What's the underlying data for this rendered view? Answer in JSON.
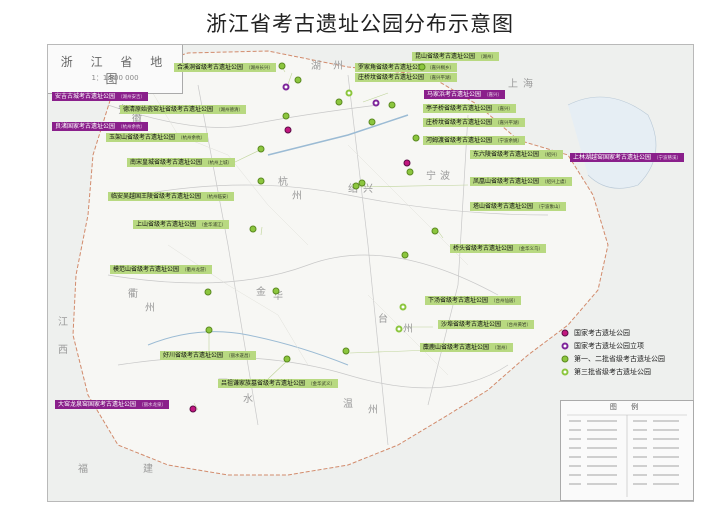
{
  "title": "浙江省考古遗址公园分布示意图",
  "inset": {
    "title": "浙 江 省 地 图",
    "scale": "1：1 800 000"
  },
  "legend": [
    {
      "key": "national",
      "label": "国家考古遗址公园"
    },
    {
      "key": "national-proj",
      "label": "国家考古遗址公园立项"
    },
    {
      "key": "prov12",
      "label": "第一、二批省级考古遗址公园"
    },
    {
      "key": "prov3",
      "label": "第三批省级考古遗址公园"
    }
  ],
  "map_legend_title": "图 例",
  "regions": [
    "湖",
    "州",
    "杭",
    "州",
    "绍",
    "兴",
    "宁",
    "波",
    "金",
    "华",
    "衢",
    "州",
    "台",
    "州",
    "丽",
    "水",
    "温",
    "州",
    "福",
    "建",
    "江",
    "西",
    "安",
    "徽",
    "上",
    "海"
  ],
  "colors": {
    "national": "#c2177f",
    "national_proj": "#7d259a",
    "provincial": "#8cc63e",
    "label_green": "#b8d981",
    "label_purple": "#8a1f8b"
  },
  "sites": [
    {
      "name": "昆山省级考古遗址公园",
      "sub": "（湖州）",
      "type": "prov12",
      "style": "green"
    },
    {
      "name": "合溪洞省级考古遗址公园",
      "sub": "（湖州长兴）",
      "type": "prov12",
      "style": "green"
    },
    {
      "name": "罗家角省级考古遗址公园",
      "sub": "（嘉兴桐乡）",
      "type": "prov3",
      "style": "green"
    },
    {
      "name": "庄桥坟省级考古遗址公园",
      "sub": "（嘉兴平湖）",
      "type": "prov12",
      "style": "green"
    },
    {
      "name": "马家浜考古遗址公园",
      "sub": "（嘉兴）",
      "type": "national-proj",
      "style": "purple"
    },
    {
      "name": "安吉古城考古遗址公园",
      "sub": "（湖州安吉）",
      "type": "national-proj",
      "style": "purple"
    },
    {
      "name": "德清原始瓷窑址省级考古遗址公园",
      "sub": "（湖州德清）",
      "type": "prov12",
      "style": "green"
    },
    {
      "name": "良渚国家考古遗址公园",
      "sub": "（杭州余杭）",
      "type": "national",
      "style": "purple"
    },
    {
      "name": "玉架山省级考古遗址公园",
      "sub": "（杭州余杭）",
      "type": "prov12",
      "style": "green"
    },
    {
      "name": "亭子桥省级考古遗址公园",
      "sub": "（嘉兴）",
      "type": "prov12",
      "style": "green"
    },
    {
      "name": "庄桥坟省级考古遗址公园",
      "sub": "（嘉兴平湖）",
      "type": "prov12",
      "style": "green"
    },
    {
      "name": "河姆渡省级考古遗址公园",
      "sub": "（宁波余姚）",
      "type": "prov12",
      "style": "green"
    },
    {
      "name": "南宋皇城省级考古遗址公园",
      "sub": "（杭州上城）",
      "type": "prov12",
      "style": "green"
    },
    {
      "name": "东六陵省级考古遗址公园",
      "sub": "（绍兴）",
      "type": "prov12",
      "style": "green"
    },
    {
      "name": "上林湖越窑国家考古遗址公园",
      "sub": "（宁波慈溪）",
      "type": "national",
      "style": "purple"
    },
    {
      "name": "凤凰山省级考古遗址公园",
      "sub": "（绍兴上虞）",
      "type": "prov12",
      "style": "green"
    },
    {
      "name": "临安吴越国王陵省级考古遗址公园",
      "sub": "（杭州临安）",
      "type": "prov12",
      "style": "green"
    },
    {
      "name": "塔山省级考古遗址公园",
      "sub": "（宁波象山）",
      "type": "prov12",
      "style": "green"
    },
    {
      "name": "上山省级考古遗址公园",
      "sub": "（金华浦江）",
      "type": "prov12",
      "style": "green"
    },
    {
      "name": "桥头省级考古遗址公园",
      "sub": "（金华义乌）",
      "type": "prov12",
      "style": "green"
    },
    {
      "name": "模范山省级考古遗址公园",
      "sub": "（衢州龙游）",
      "type": "prov12",
      "style": "green"
    },
    {
      "name": "下汤省级考古遗址公园",
      "sub": "（台州仙居）",
      "type": "prov3",
      "style": "green"
    },
    {
      "name": "沙埠省级考古遗址公园",
      "sub": "（台州黄岩）",
      "type": "prov12",
      "style": "green"
    },
    {
      "name": "麋鹿山省级考古遗址公园",
      "sub": "（温州）",
      "type": "prov12",
      "style": "green"
    },
    {
      "name": "好川省级考古遗址公园",
      "sub": "（丽水遂昌）",
      "type": "prov12",
      "style": "green"
    },
    {
      "name": "吕祖谦家族墓省级考古遗址公园",
      "sub": "（金华武义）",
      "type": "prov12",
      "style": "green"
    },
    {
      "name": "大窑龙泉窑国家考古遗址公园",
      "sub": "（丽水龙泉）",
      "type": "national",
      "style": "purple"
    }
  ]
}
